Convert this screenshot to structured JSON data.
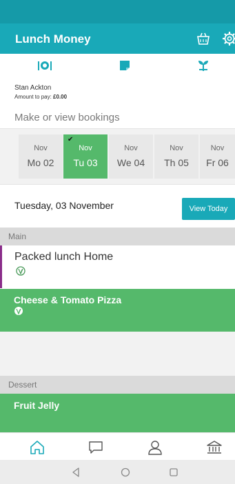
{
  "colors": {
    "statusbar": "#159aa8",
    "appbar": "#19a9b8",
    "selected_day": "#55b96b",
    "meal_selected": "#55b96b",
    "packed_accent": "#8a2d8a"
  },
  "appbar": {
    "title": "Lunch Money",
    "icons": [
      "basket-icon",
      "gear-icon"
    ]
  },
  "topicons": [
    "cutlery-plate-icon",
    "note-icon",
    "plant-icon"
  ],
  "account": {
    "user_name": "Stan Ackton",
    "amount_label": "Amount to pay:",
    "amount_value": "£0.00"
  },
  "bookings_label": "Make or view bookings",
  "days": [
    {
      "month": "Nov",
      "date": "Mo 02",
      "selected": false
    },
    {
      "month": "Nov",
      "date": "Tu 03",
      "selected": true
    },
    {
      "month": "Nov",
      "date": "We 04",
      "selected": false
    },
    {
      "month": "Nov",
      "date": "Th 05",
      "selected": false
    },
    {
      "month": "Nov",
      "date": "Fr 06",
      "selected": false
    }
  ],
  "date_header": "Tuesday, 03 November",
  "view_today_label": "View Today",
  "sections": {
    "main": "Main",
    "dessert": "Dessert"
  },
  "meals": {
    "packed": "Packed lunch Home",
    "pizza": "Cheese & Tomato Pizza",
    "jelly": "Fruit Jelly"
  },
  "bottom_nav": [
    "home-icon",
    "chat-icon",
    "profile-icon",
    "bank-icon"
  ],
  "system_nav": [
    "back-icon",
    "home-circle-icon",
    "recents-icon"
  ]
}
